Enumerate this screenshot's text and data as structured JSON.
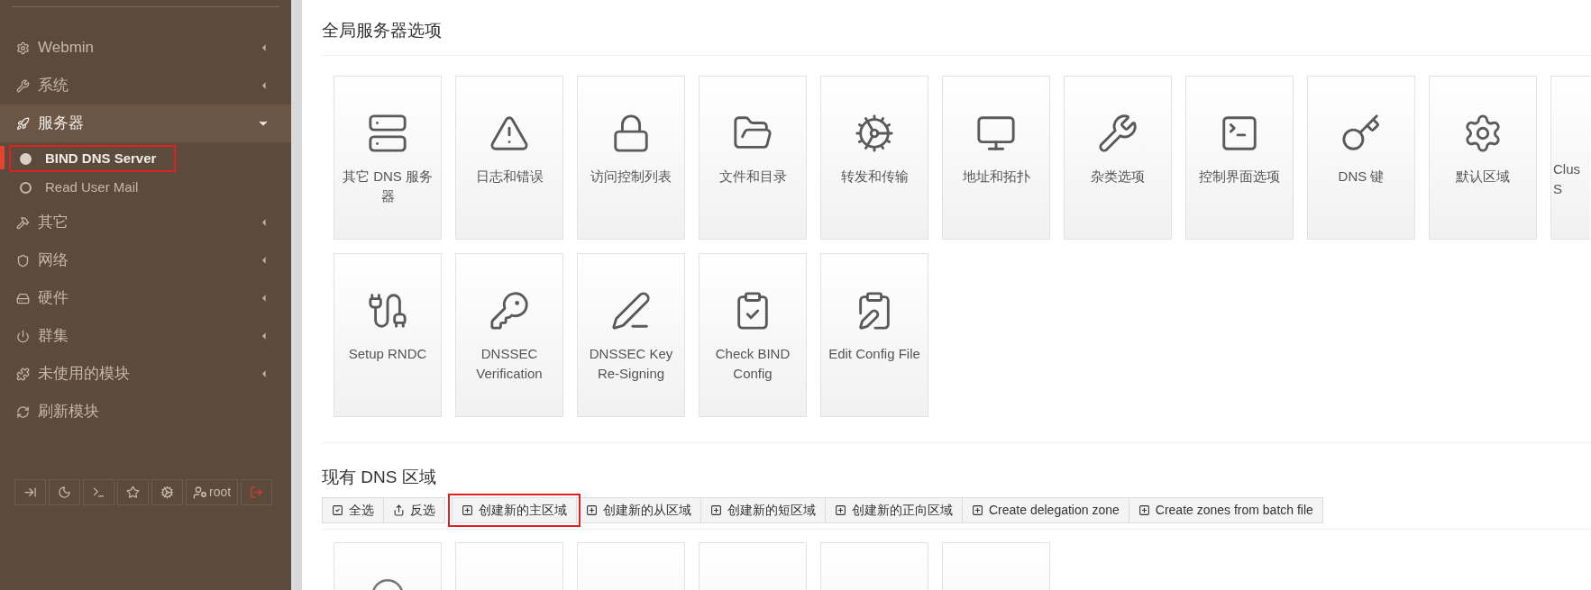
{
  "sidebar": {
    "menu": [
      {
        "label": "Webmin",
        "kind": "group",
        "expanded": false
      },
      {
        "label": "系统",
        "kind": "group",
        "expanded": false
      },
      {
        "label": "服务器",
        "kind": "group",
        "expanded": true,
        "children": [
          {
            "label": "BIND DNS Server",
            "selected": true,
            "annotated": true
          },
          {
            "label": "Read User Mail",
            "selected": false,
            "annotated": false
          }
        ]
      },
      {
        "label": "其它",
        "kind": "group",
        "expanded": false
      },
      {
        "label": "网络",
        "kind": "group",
        "expanded": false
      },
      {
        "label": "硬件",
        "kind": "group",
        "expanded": false
      },
      {
        "label": "群集",
        "kind": "group",
        "expanded": false
      },
      {
        "label": "未使用的模块",
        "kind": "group",
        "expanded": false
      },
      {
        "label": "刷新模块",
        "kind": "action"
      }
    ],
    "user_button": {
      "label": "root"
    }
  },
  "global_section": {
    "title": "全局服务器选项",
    "tile_rows": [
      {
        "tiles": [
          {
            "label": "其它 DNS 服务器",
            "kind": "full"
          },
          {
            "label": "日志和错误",
            "kind": "full"
          },
          {
            "label": "访问控制列表",
            "kind": "full"
          },
          {
            "label": "文件和目录",
            "kind": "full"
          },
          {
            "label": "转发和传输",
            "kind": "full"
          },
          {
            "label": "地址和拓扑",
            "kind": "full"
          },
          {
            "label": "杂类选项",
            "kind": "full"
          },
          {
            "label": "控制界面选项",
            "kind": "full"
          },
          {
            "label": "DNS 键",
            "kind": "full"
          },
          {
            "label": "默认区域",
            "kind": "full"
          },
          {
            "label": "Clus S",
            "kind": "cut"
          }
        ]
      },
      {
        "tiles": [
          {
            "label": "Setup RNDC",
            "kind": "full"
          },
          {
            "label": "DNSSEC Verification",
            "kind": "full"
          },
          {
            "label": "DNSSEC Key Re-Signing",
            "kind": "full"
          },
          {
            "label": "Check BIND Config",
            "kind": "full"
          },
          {
            "label": "Edit Config File",
            "kind": "full"
          }
        ]
      }
    ]
  },
  "zones_section": {
    "title": "现有 DNS 区域",
    "selection_buttons": [
      "全选",
      "反选"
    ],
    "create_buttons": [
      {
        "label": "创建新的主区域",
        "annotated": true
      },
      {
        "label": "创建新的从区域",
        "annotated": false
      },
      {
        "label": "创建新的短区域",
        "annotated": false
      },
      {
        "label": "创建新的正向区域",
        "annotated": false
      },
      {
        "label": "Create delegation zone",
        "annotated": false
      },
      {
        "label": "Create zones from batch file",
        "annotated": false
      }
    ],
    "zone_tiles": [
      {
        "kind": "icon"
      },
      {
        "kind": "empty"
      },
      {
        "kind": "empty"
      },
      {
        "kind": "empty"
      },
      {
        "kind": "empty"
      },
      {
        "kind": "empty"
      }
    ]
  }
}
